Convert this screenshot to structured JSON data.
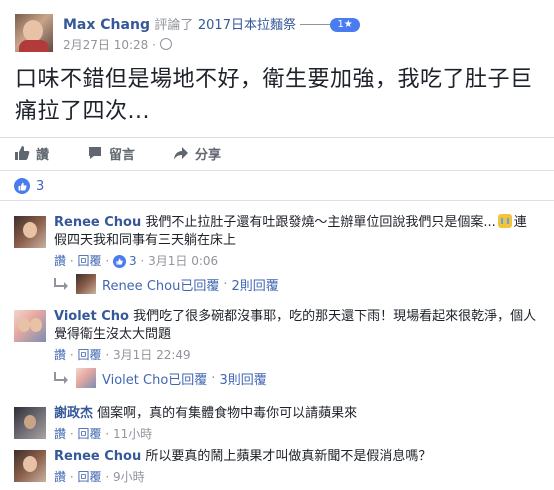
{
  "post": {
    "author": "Max Chang",
    "activity_prefix": "評論了",
    "group": "2017日本拉麵祭",
    "group_badge": "1★",
    "date": "2月27日 10:28",
    "separator": "·",
    "text": "口味不錯但是場地不好，衛生要加強，我吃了肚子巨痛拉了四次..."
  },
  "actions": [
    {
      "label": "讚",
      "icon": "thumbs-up-icon"
    },
    {
      "label": "留言",
      "icon": "comment-icon"
    },
    {
      "label": "分享",
      "icon": "share-icon"
    }
  ],
  "likes": {
    "count": "3",
    "icon": "like-badge-icon"
  },
  "comments": [
    {
      "author": "Renee Chou",
      "text_line1": "我們不止拉肚子還有吐跟發燒～主辦單位回說我們只是個案...",
      "emoji": "crying-face-icon",
      "text_line1_tail": "連",
      "text_line2": "假四天我和同事有三天躺在床上",
      "like": "讚",
      "dot": "·",
      "reply": "回覆",
      "reaction_count": "3",
      "time": "3月1日 0:06",
      "replies_author": "Renee Chou已回覆",
      "replies_count": "2則回覆"
    },
    {
      "author": "Violet Cho",
      "text_line1": "我們吃了很多碗都沒事耶，吃的那天還下雨！現場看起來很乾淨，個人",
      "text_line2": "覺得衛生沒太大問題",
      "like": "讚",
      "dot": "·",
      "reply": "回覆",
      "time": "3月1日 22:49",
      "replies_author": "Violet Cho已回覆",
      "replies_count": "3則回覆"
    },
    {
      "author": "謝政杰",
      "text_line1": "個案啊，真的有集體食物中毒你可以請蘋果來",
      "like": "讚",
      "dot": "·",
      "reply": "回覆",
      "time": "11小時"
    },
    {
      "author": "Renee Chou",
      "text_line1": "所以要真的鬧上蘋果才叫做真新聞不是假消息嗎？",
      "like": "讚",
      "dot": "·",
      "reply": "回覆",
      "time": "9小時"
    }
  ],
  "colors": {
    "link": "#365899",
    "accent": "#4267b2",
    "meta": "#90949c",
    "like_blue": "#4a7cf0"
  }
}
